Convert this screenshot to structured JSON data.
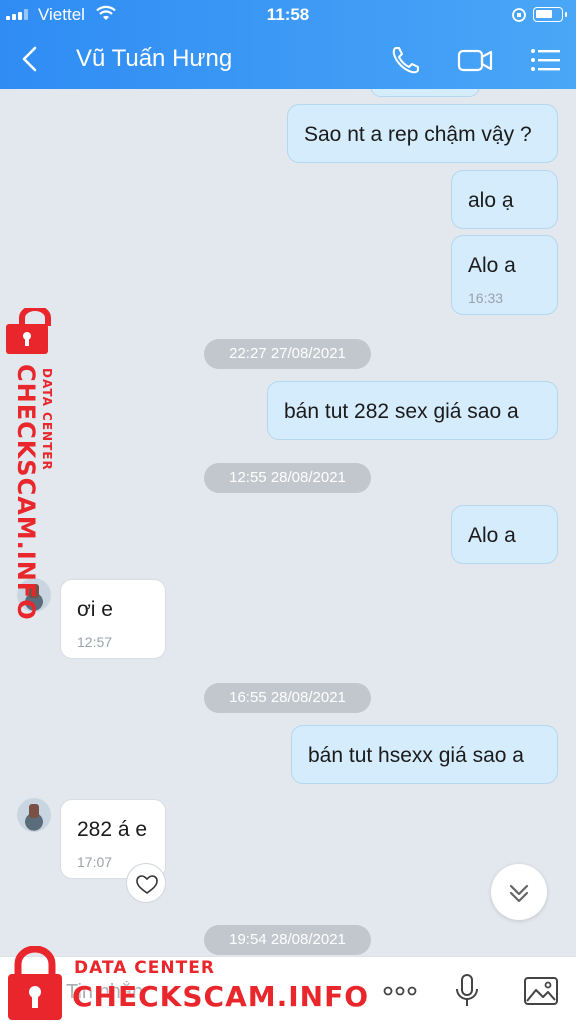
{
  "status_bar": {
    "carrier": "Viettel",
    "time": "11:58"
  },
  "header": {
    "contact_name": "Vũ Tuấn Hưng"
  },
  "messages": [
    {
      "text": "Sao nt a rep chậm vậy ?"
    },
    {
      "text": "alo ạ"
    },
    {
      "text": "Alo a",
      "time": "16:33"
    },
    {
      "date": "22:27 27/08/2021"
    },
    {
      "text": "bán tut 282 sex giá sao a"
    },
    {
      "date": "12:55 28/08/2021"
    },
    {
      "text": "Alo a"
    },
    {
      "text": "ơi e",
      "time": "12:57"
    },
    {
      "date": "16:55 28/08/2021"
    },
    {
      "text": "bán tut hsexx giá sao a"
    },
    {
      "text": "282 á e",
      "time": "17:07"
    },
    {
      "date": "19:54 28/08/2021"
    }
  ],
  "composer": {
    "placeholder": "Tin nhắn"
  },
  "watermark": {
    "title": "CHECKSCAM.INFO",
    "subtitle": "DATA CENTER"
  },
  "colors": {
    "header": "#3a96f5",
    "outgoing_bubble": "#d4ecfb",
    "incoming_bubble": "#ffffff",
    "watermark": "#e8262b"
  }
}
